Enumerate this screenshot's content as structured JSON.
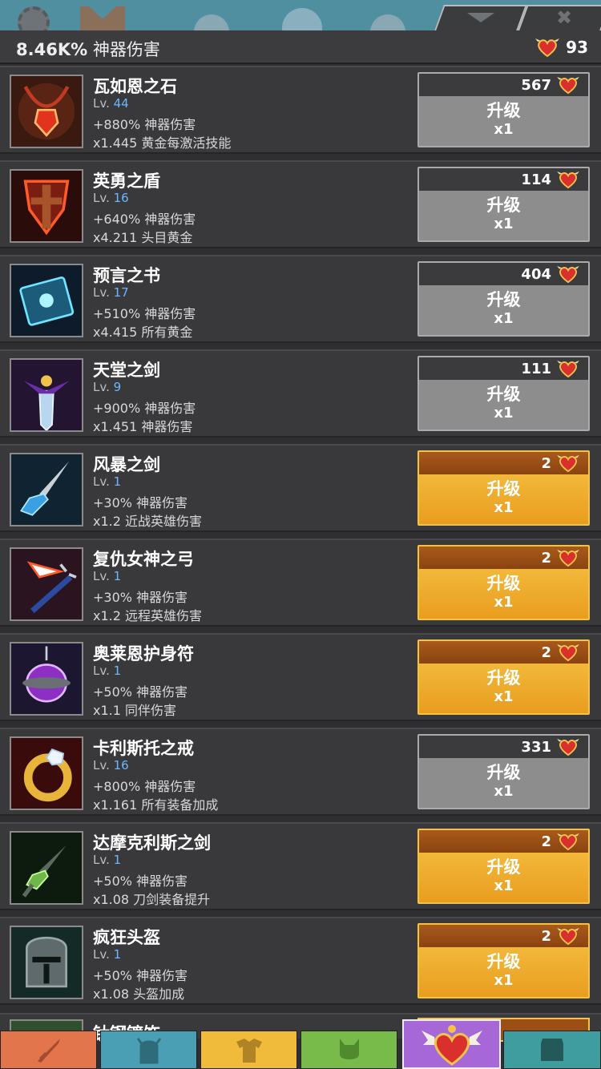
{
  "header": {
    "damage_value": "8.46K%",
    "damage_label": "神器伤害",
    "relics_count": "93"
  },
  "top_tabs": [
    {
      "icon": "chevron-down-icon"
    },
    {
      "icon": "close-icon"
    }
  ],
  "artifacts": [
    {
      "name": "瓦如恩之石",
      "lv_label": "Lv.",
      "lv": "44",
      "effect1": "+880% 神器伤害",
      "effect2": "x1.445 黄金每激活技能",
      "cost": "567",
      "upgrade_label": "升级",
      "multiplier": "x1",
      "affordable": false,
      "icon": "red-gem-amulet-icon"
    },
    {
      "name": "英勇之盾",
      "lv_label": "Lv.",
      "lv": "16",
      "effect1": "+640% 神器伤害",
      "effect2": "x4.211 头目黄金",
      "cost": "114",
      "upgrade_label": "升级",
      "multiplier": "x1",
      "affordable": false,
      "icon": "shield-icon"
    },
    {
      "name": "预言之书",
      "lv_label": "Lv.",
      "lv": "17",
      "effect1": "+510% 神器伤害",
      "effect2": "x4.415 所有黄金",
      "cost": "404",
      "upgrade_label": "升级",
      "multiplier": "x1",
      "affordable": false,
      "icon": "book-icon"
    },
    {
      "name": "天堂之剑",
      "lv_label": "Lv.",
      "lv": "9",
      "effect1": "+900% 神器伤害",
      "effect2": "x1.451 神器伤害",
      "cost": "111",
      "upgrade_label": "升级",
      "multiplier": "x1",
      "affordable": false,
      "icon": "heavenly-sword-icon"
    },
    {
      "name": "风暴之剑",
      "lv_label": "Lv.",
      "lv": "1",
      "effect1": "+30% 神器伤害",
      "effect2": "x1.2 近战英雄伤害",
      "cost": "2",
      "upgrade_label": "升级",
      "multiplier": "x1",
      "affordable": true,
      "icon": "storm-sword-icon"
    },
    {
      "name": "复仇女神之弓",
      "lv_label": "Lv.",
      "lv": "1",
      "effect1": "+30% 神器伤害",
      "effect2": "x1.2 远程英雄伤害",
      "cost": "2",
      "upgrade_label": "升级",
      "multiplier": "x1",
      "affordable": true,
      "icon": "bow-icon"
    },
    {
      "name": "奥莱恩护身符",
      "lv_label": "Lv.",
      "lv": "1",
      "effect1": "+50% 神器伤害",
      "effect2": "x1.1 同伴伤害",
      "cost": "2",
      "upgrade_label": "升级",
      "multiplier": "x1",
      "affordable": true,
      "icon": "amulet-icon"
    },
    {
      "name": "卡利斯托之戒",
      "lv_label": "Lv.",
      "lv": "16",
      "effect1": "+800% 神器伤害",
      "effect2": "x1.161 所有装备加成",
      "cost": "331",
      "upgrade_label": "升级",
      "multiplier": "x1",
      "affordable": false,
      "icon": "ring-icon"
    },
    {
      "name": "达摩克利斯之剑",
      "lv_label": "Lv.",
      "lv": "1",
      "effect1": "+50% 神器伤害",
      "effect2": "x1.08 刀剑装备提升",
      "cost": "2",
      "upgrade_label": "升级",
      "multiplier": "x1",
      "affordable": true,
      "icon": "green-dagger-icon"
    },
    {
      "name": "疯狂头盔",
      "lv_label": "Lv.",
      "lv": "1",
      "effect1": "+50% 神器伤害",
      "effect2": "x1.08 头盔加成",
      "cost": "2",
      "upgrade_label": "升级",
      "multiplier": "x1",
      "affordable": true,
      "icon": "helmet-icon"
    }
  ],
  "partial_row": {
    "name": "钛钢镰饰"
  },
  "bottom_nav": [
    {
      "icon": "sword-icon",
      "color": "#e3754d"
    },
    {
      "icon": "knight-helmet-icon",
      "color": "#4a9fb4"
    },
    {
      "icon": "armor-icon",
      "color": "#f0bb3b"
    },
    {
      "icon": "pet-icon",
      "color": "#79bb4b"
    },
    {
      "icon": "winged-heart-icon",
      "color": "#a668d6",
      "active": true
    },
    {
      "icon": "shop-icon",
      "color": "#3f9d9f"
    }
  ],
  "colors": {
    "affordable_button": "#f2b83a",
    "disabled_button": "#8d8d8d",
    "level_number": "#6cb7ff"
  }
}
